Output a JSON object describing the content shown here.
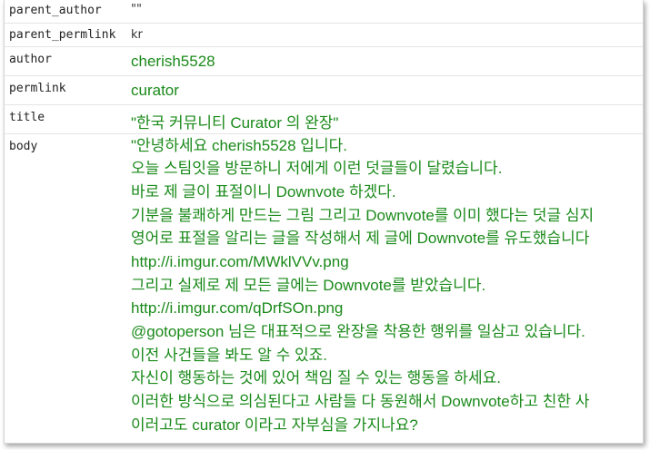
{
  "rows": {
    "parent_author": {
      "key": "parent_author",
      "value": "\"\""
    },
    "parent_permlink": {
      "key": "parent_permlink",
      "value": "kr"
    },
    "author": {
      "key": "author",
      "value": "cherish5528"
    },
    "permlink": {
      "key": "permlink",
      "value": "curator"
    },
    "title": {
      "key": "title",
      "value": "\"한국 커뮤니티 Curator 의 완장\""
    },
    "body": {
      "key": "body",
      "lines": [
        "\"안녕하세요 cherish5528 입니다.",
        "오늘 스팀잇을 방문하니 저에게 이런 덧글들이 달렸습니다.",
        "바로 제 글이 표절이니 Downvote 하겠다.",
        "기분을 불쾌하게 만드는 그림 그리고 Downvote를 이미 했다는 덧글 심지",
        "영어로 표절을 알리는 글을 작성해서 제 글에 Downvote를 유도했습니다",
        "http://i.imgur.com/MWklVVv.png",
        "그리고 실제로 제 모든 글에는 Downvote를 받았습니다.",
        "http://i.imgur.com/qDrfSOn.png",
        "@gotoperson 님은 대표적으로 완장을 착용한 행위를 일삼고 있습니다.",
        "이전 사건들을 봐도 알 수 있죠.",
        "자신이 행동하는 것에 있어 책임 질 수 있는 행동을 하세요.",
        "이러한 방식으로 의심된다고 사람들 다 동원해서 Downvote하고 친한 사",
        "이러고도 curator 이라고 자부심을 가지나요?"
      ]
    }
  }
}
